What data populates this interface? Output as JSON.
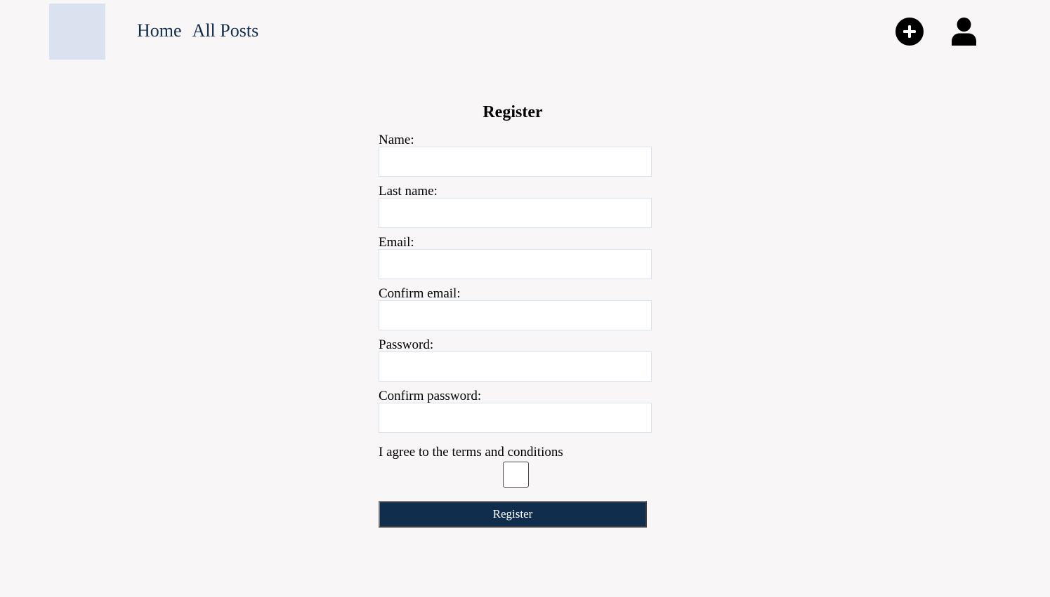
{
  "colors": {
    "page_background": "#f8f6f7",
    "logo_placeholder": "#dbe2ef",
    "nav_link": "#112d4e",
    "button_primary": "#112d4e",
    "input_border": "#dbe2ef"
  },
  "header": {
    "nav": [
      {
        "label": "Home"
      },
      {
        "label": "All Posts"
      }
    ],
    "icons": {
      "add": "plus-circle-icon",
      "user": "user-icon"
    }
  },
  "form": {
    "title": "Register",
    "fields": [
      {
        "label": "Name:",
        "value": "",
        "placeholder": ""
      },
      {
        "label": "Last name:",
        "value": "",
        "placeholder": ""
      },
      {
        "label": "Email:",
        "value": "",
        "placeholder": ""
      },
      {
        "label": "Confirm email:",
        "value": "",
        "placeholder": ""
      },
      {
        "label": "Password:",
        "value": "",
        "placeholder": ""
      },
      {
        "label": "Confirm password:",
        "value": "",
        "placeholder": ""
      }
    ],
    "terms_label": "I agree to the terms and conditions",
    "terms_checked": false,
    "submit_label": "Register"
  }
}
